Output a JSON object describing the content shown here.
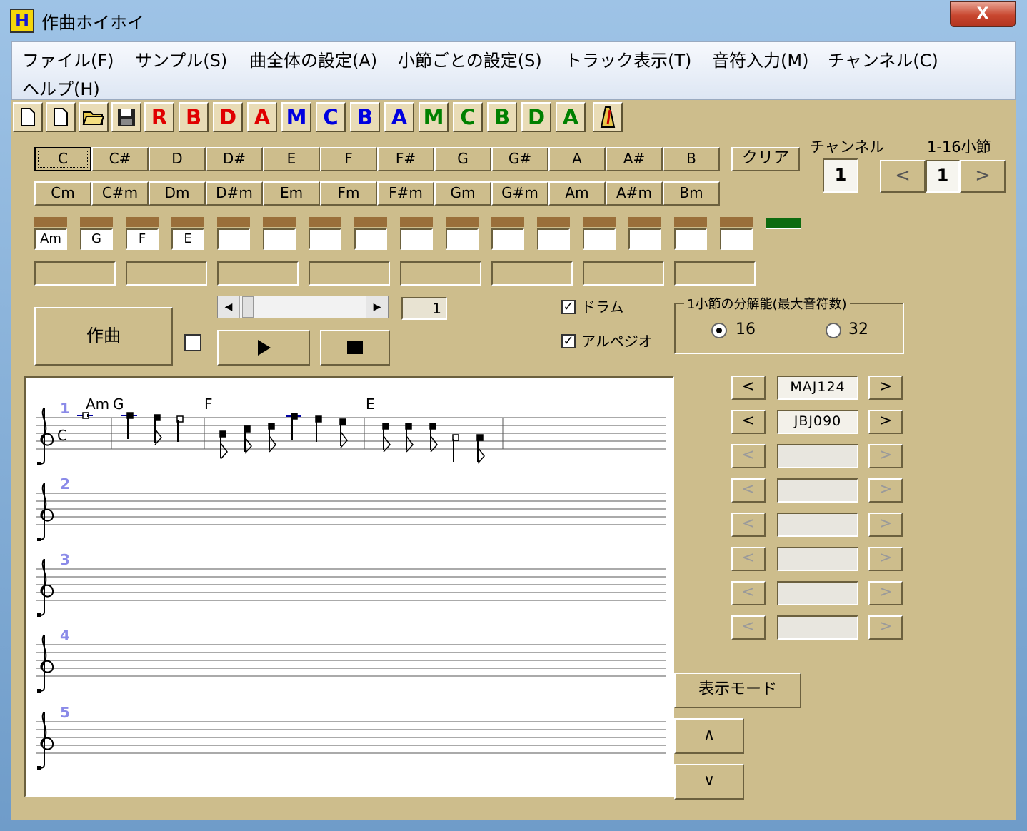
{
  "window": {
    "title": "作曲ホイホイ",
    "close_label": "X",
    "icon_label": "H"
  },
  "menu": [
    "ファイル(F)",
    "サンプル(S)",
    "曲全体の設定(A)",
    "小節ごとの設定(S)",
    "トラック表示(T)",
    "音符入力(M)",
    "チャンネル(C)",
    "ヘルプ(H)"
  ],
  "toolbar": [
    {
      "label": "",
      "icon": "new-file-icon"
    },
    {
      "label": "",
      "icon": "new-file-icon"
    },
    {
      "label": "",
      "icon": "open-folder-icon"
    },
    {
      "label": "",
      "icon": "save-icon"
    },
    {
      "label": "R",
      "color": "#e00000"
    },
    {
      "label": "B",
      "color": "#e00000"
    },
    {
      "label": "D",
      "color": "#e00000"
    },
    {
      "label": "A",
      "color": "#e00000"
    },
    {
      "label": "M",
      "color": "#0000e0"
    },
    {
      "label": "C",
      "color": "#0000e0"
    },
    {
      "label": "B",
      "color": "#0000e0"
    },
    {
      "label": "A",
      "color": "#0000e0"
    },
    {
      "label": "M",
      "color": "#008000"
    },
    {
      "label": "C",
      "color": "#008000"
    },
    {
      "label": "B",
      "color": "#008000"
    },
    {
      "label": "D",
      "color": "#008000"
    },
    {
      "label": "A",
      "color": "#008000"
    },
    {
      "label": "",
      "icon": "metronome-icon"
    }
  ],
  "chords_major": [
    "C",
    "C#",
    "D",
    "D#",
    "E",
    "F",
    "F#",
    "G",
    "G#",
    "A",
    "A#",
    "B"
  ],
  "chords_minor": [
    "Cm",
    "C#m",
    "Dm",
    "D#m",
    "Em",
    "Fm",
    "F#m",
    "Gm",
    "G#m",
    "Am",
    "A#m",
    "Bm"
  ],
  "clear_label": "クリア",
  "channel": {
    "label": "チャンネル",
    "value": "1"
  },
  "measure": {
    "label": "1-16小節",
    "value": "1",
    "prev": "<",
    "next": ">"
  },
  "measure_chords": [
    "Am",
    "G",
    "F",
    "E",
    "",
    "",
    "",
    "",
    "",
    "",
    "",
    "",
    "",
    "",
    "",
    ""
  ],
  "compose_label": "作曲",
  "tempo_value": "1",
  "drum_label": "ドラム",
  "arpeggio_label": "アルペジオ",
  "resolution": {
    "label": "1小節の分解能(最大音符数)",
    "options": [
      "16",
      "32"
    ],
    "selected": "16"
  },
  "patterns": [
    "MAJ124",
    "JBJ090",
    "",
    "",
    "",
    "",
    "",
    ""
  ],
  "display_mode_label": "表示モード",
  "up_label": "∧",
  "down_label": "∨",
  "score": {
    "key_label": "C",
    "staff_numbers": [
      "1",
      "2",
      "3",
      "4",
      "5"
    ],
    "chord_labels": [
      "Am",
      "G",
      "F",
      "E"
    ]
  },
  "colors": {
    "accent": "#1a8a1a",
    "panel": "#cdbd8c",
    "chord_bar": "#9a6f3a",
    "staff_number": "#8a8ae8"
  }
}
